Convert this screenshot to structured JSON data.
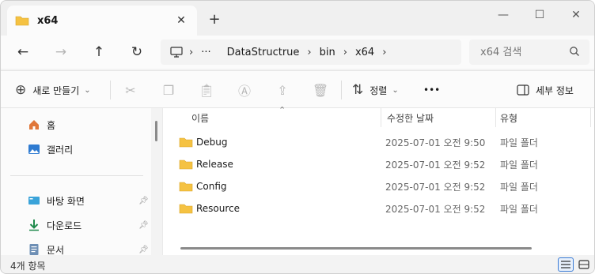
{
  "tab": {
    "title": "x64",
    "close": "✕",
    "new_tab": "+"
  },
  "window_controls": {
    "minimize": "—",
    "maximize": "☐",
    "close": "✕"
  },
  "nav": {
    "back": "←",
    "forward": "→",
    "up": "↑",
    "refresh": "↻",
    "breadcrumbs": [
      "DataStructrue",
      "bin",
      "x64"
    ],
    "more": "···",
    "separator": "›"
  },
  "search": {
    "placeholder": "x64 검색"
  },
  "command_bar": {
    "new_label": "새로 만들기",
    "sort_label": "정렬",
    "more": "•••",
    "details_label": "세부 정보"
  },
  "sidebar": {
    "items": [
      {
        "label": "홈",
        "icon": "home-icon"
      },
      {
        "label": "갤러리",
        "icon": "gallery-icon"
      },
      {
        "label": "바탕 화면",
        "icon": "desktop-icon",
        "pinned": true
      },
      {
        "label": "다운로드",
        "icon": "download-icon",
        "pinned": true
      },
      {
        "label": "문서",
        "icon": "documents-icon",
        "pinned": true
      }
    ]
  },
  "columns": {
    "name": "이름",
    "modified": "수정한 날짜",
    "type": "유형"
  },
  "files": [
    {
      "name": "Debug",
      "modified": "2025-07-01 오전 9:50",
      "type": "파일 폴더"
    },
    {
      "name": "Release",
      "modified": "2025-07-01 오전 9:52",
      "type": "파일 폴더"
    },
    {
      "name": "Config",
      "modified": "2025-07-01 오전 9:52",
      "type": "파일 폴더"
    },
    {
      "name": "Resource",
      "modified": "2025-07-01 오전 9:52",
      "type": "파일 폴더"
    }
  ],
  "status": {
    "item_count": "4개 항목"
  },
  "colors": {
    "folder": "#f5c242",
    "accent": "#3a7bd5",
    "home": "#e0773a"
  }
}
